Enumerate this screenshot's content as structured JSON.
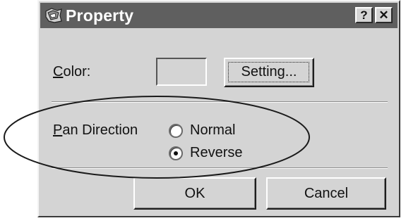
{
  "window": {
    "title": "Property",
    "help_label": "?",
    "close_label": "✕"
  },
  "color": {
    "label_first": "C",
    "label_rest": "olor:",
    "setting_button": "Setting..."
  },
  "pan_direction": {
    "label_first": "P",
    "label_rest": "an Direction",
    "options": [
      {
        "label": "Normal",
        "selected": false
      },
      {
        "label": "Reverse",
        "selected": true
      }
    ]
  },
  "buttons": {
    "ok_label": "OK",
    "cancel_label": "Cancel"
  },
  "colors": {
    "dialog_background": "#d4d4d4",
    "titlebar": "#5f5f5f",
    "annotation_outline": "#1a1a1a"
  },
  "icons": {
    "window_icon": "dialog-app-icon"
  }
}
